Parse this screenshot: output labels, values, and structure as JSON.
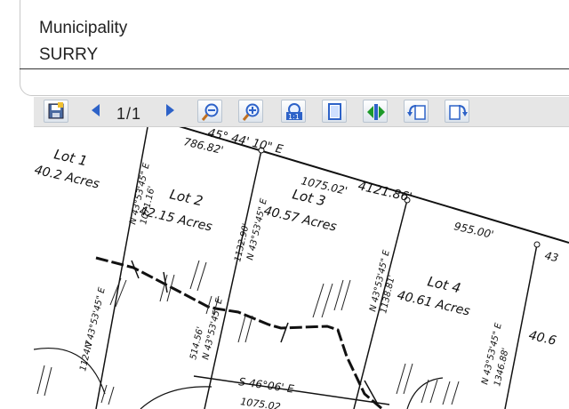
{
  "field": {
    "label": "Municipality",
    "value": "SURRY"
  },
  "toolbar": {
    "page_indicator": "1/1",
    "buttons": [
      {
        "name": "save-icon"
      },
      {
        "name": "previous-page-icon"
      },
      {
        "name": "next-page-icon"
      },
      {
        "name": "zoom-out-icon"
      },
      {
        "name": "zoom-in-icon"
      },
      {
        "name": "actual-size-icon"
      },
      {
        "name": "fit-page-icon"
      },
      {
        "name": "fit-width-icon"
      },
      {
        "name": "rotate-left-icon"
      },
      {
        "name": "rotate-right-icon"
      }
    ]
  },
  "plat": {
    "lots": [
      {
        "name": "Lot 1",
        "acres": "40.2 Acres"
      },
      {
        "name": "Lot 2",
        "acres": "42.15 Acres"
      },
      {
        "name": "Lot 3",
        "acres": "40.57 Acres"
      },
      {
        "name": "Lot 4",
        "acres": "40.61 Acres"
      },
      {
        "name": "",
        "acres": "40.6"
      }
    ],
    "bearings": {
      "top_line": "45° 44' 10\" E",
      "top_seg1": "786.82'",
      "top_seg2": "1075.02'",
      "top_total": "4121.86'",
      "top_seg3": "955.00'",
      "top_seg4": "43",
      "lot1_side": "N 43°53'45\" E",
      "lot1_side_dist": "1071.16'",
      "lot2_side": "1132.90'",
      "lot2_side_b": "N 43°53'45\" E",
      "lot3_side": "N 43°53'45\" E",
      "lot3_side_dist": "1138.81'",
      "lot4_side": "N 43°53'45\" E",
      "lot4_side_dist": "1346.88'",
      "left_side": "N 43°53'45\" E",
      "left_side_dist": "1124.7",
      "bottom_line": "S 46°06' E",
      "bottom_dist": "1075.02",
      "lot2_mid": "514.56'",
      "lot2_mid_b": "N 43°53'45\" E"
    }
  }
}
